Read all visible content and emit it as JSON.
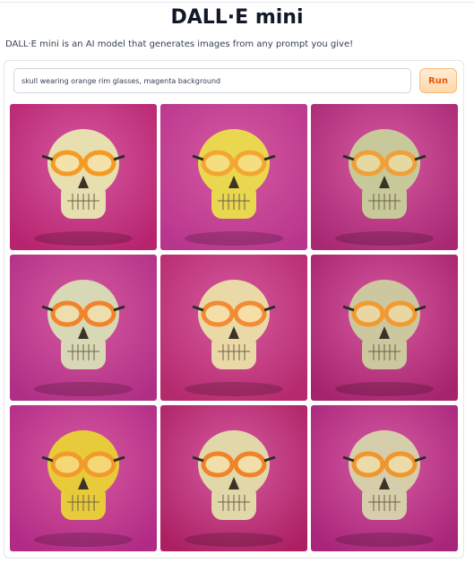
{
  "app": {
    "title": "DALL·E mini",
    "description": "DALL·E mini is an AI model that generates images from any prompt you give!"
  },
  "prompt": {
    "value": "skull wearing orange rim glasses, magenta background"
  },
  "run_button": {
    "label": "Run"
  },
  "colors": {
    "accent": "#ea580c",
    "accent_bg": "#fed7aa",
    "magenta_bg": "#b5267a"
  },
  "results": [
    {
      "name": "generated-image-1",
      "bg": "#b7236f",
      "skull": "#e7dfb0",
      "glasses": "#f59a23"
    },
    {
      "name": "generated-image-2",
      "bg": "#b8358d",
      "skull": "#e9d84f",
      "glasses": "#f3a632"
    },
    {
      "name": "generated-image-3",
      "bg": "#a82874",
      "skull": "#c8c99a",
      "glasses": "#f0a038"
    },
    {
      "name": "generated-image-4",
      "bg": "#b02f86",
      "skull": "#d9d8b6",
      "glasses": "#f1832a"
    },
    {
      "name": "generated-image-5",
      "bg": "#b5296d",
      "skull": "#ead8a6",
      "glasses": "#f28b33"
    },
    {
      "name": "generated-image-6",
      "bg": "#a5226c",
      "skull": "#ccc79e",
      "glasses": "#f29a30"
    },
    {
      "name": "generated-image-7",
      "bg": "#b12a85",
      "skull": "#e8cb3a",
      "glasses": "#f29a2a"
    },
    {
      "name": "generated-image-8",
      "bg": "#ac2063",
      "skull": "#e1d7a8",
      "glasses": "#f0822a"
    },
    {
      "name": "generated-image-9",
      "bg": "#a8257a",
      "skull": "#d6ceaa",
      "glasses": "#f0962c"
    }
  ]
}
